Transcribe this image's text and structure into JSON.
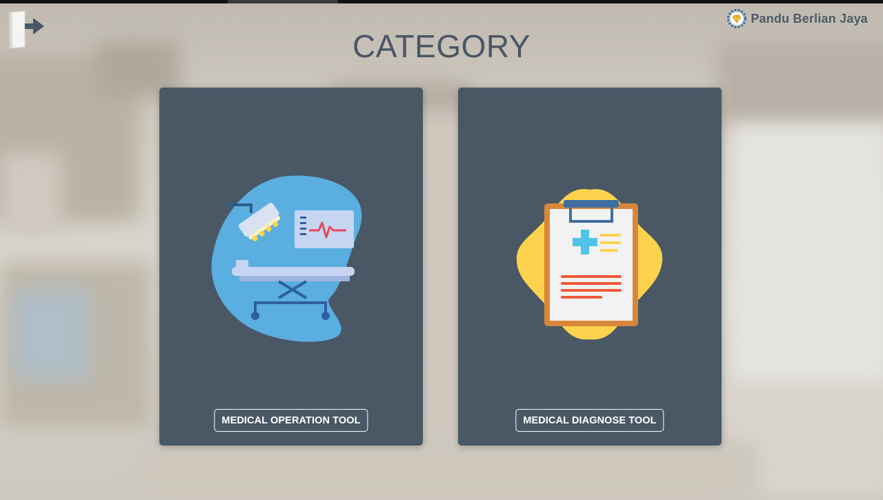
{
  "header": {
    "title": "CATEGORY",
    "brand_name": "Pandu Berlian Jaya",
    "exit_icon": "exit-door-icon",
    "brand_logo_icon": "diamond-gear-logo"
  },
  "categories": [
    {
      "label": "MEDICAL OPERATION TOOL",
      "icon": "operating-table-icon"
    },
    {
      "label": "MEDICAL DIAGNOSE TOOL",
      "icon": "clipboard-report-icon"
    }
  ],
  "colors": {
    "card_bg": "#4a5866",
    "title_text": "#4a5664",
    "brand_text": "#4d5a68",
    "operation_blob": "#5aaee0",
    "diagnose_blob": "#fdd34e",
    "clipboard_frame": "#d9863b"
  }
}
